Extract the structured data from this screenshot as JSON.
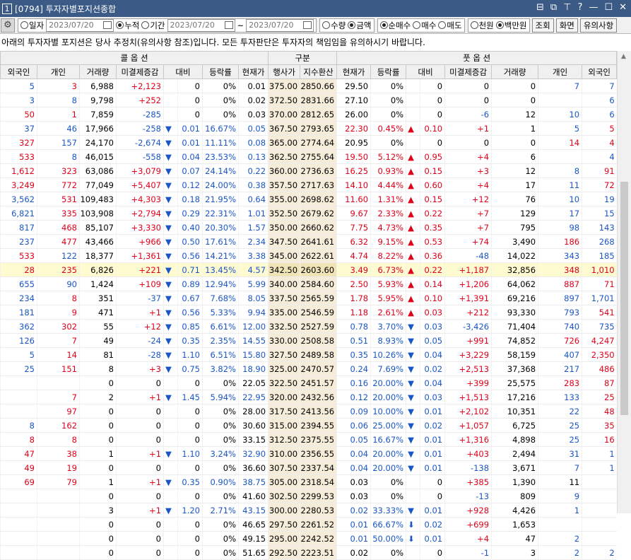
{
  "window": {
    "screen_no": "1",
    "title": "[0794] 투자자별포지션종합",
    "controls": [
      "⊟",
      "⧉",
      "⊤",
      "?",
      "—",
      "☐",
      "✕"
    ]
  },
  "toolbar": {
    "settings_icon": "gear-icon",
    "date_mode": {
      "daily": "일자",
      "cumulative": "누적",
      "period": "기간",
      "selected": "누적"
    },
    "date1": "2023/07/20",
    "date2": "2023/07/20",
    "date3": "2023/07/20",
    "tilde": "~",
    "unit": {
      "qty": "수량",
      "amount": "금액",
      "selected": "금액"
    },
    "trade": {
      "net": "순매수",
      "buy": "매수",
      "sell": "매도",
      "selected": "순매수"
    },
    "money": {
      "won": "천원",
      "million": "백만원",
      "selected": "백만원"
    },
    "query": "조회",
    "screen": "화면",
    "notice_btn": "유의사항"
  },
  "notice": "아래의 투자자별 포지션은 당사 추정치(유의사항 참조)입니다. 모든 투자판단은 투자자의 책임임을 유의하시기 바랍니다.",
  "header": {
    "call": "콜 옵 션",
    "mid": "구분",
    "put": "풋 옵 션",
    "columns": [
      "외국인",
      "개인",
      "거래량",
      "미결제증감",
      "대비",
      "등락률",
      "현재가",
      "행사가",
      "지수환산",
      "현재가",
      "등락률",
      "대비",
      "미결제증감",
      "거래량",
      "개인",
      "외국인"
    ]
  },
  "colors": {
    "up": "#e0001a",
    "down": "#1a56c8",
    "strike_bg": "#f5ecd9",
    "selected_row": "#fffbd1"
  },
  "rows": [
    [
      "5",
      "3",
      "6,988",
      "+2,123",
      "",
      "0",
      "0%",
      "0.01",
      "375.00",
      "2850.66",
      "29.50",
      "0%",
      "",
      "0",
      "0",
      "0",
      "7",
      "7"
    ],
    [
      "3",
      "8",
      "9,798",
      "+252",
      "",
      "0",
      "0%",
      "0.02",
      "372.50",
      "2831.66",
      "27.10",
      "0%",
      "",
      "0",
      "0",
      "0",
      "",
      "6"
    ],
    [
      "50",
      "1",
      "7,859",
      "-285",
      "",
      "0",
      "0%",
      "0.03",
      "370.00",
      "2812.65",
      "26.00",
      "0%",
      "",
      "0",
      "-6",
      "12",
      "10",
      "6"
    ],
    [
      "37",
      "46",
      "17,966",
      "-258",
      "▼",
      "0.01",
      "16.67%",
      "0.05",
      "367.50",
      "2793.65",
      "22.30",
      "0.45%",
      "▲",
      "0.10",
      "+1",
      "1",
      "5",
      "5"
    ],
    [
      "327",
      "157",
      "24,170",
      "-2,674",
      "▼",
      "0.01",
      "11.11%",
      "0.08",
      "365.00",
      "2774.64",
      "20.95",
      "0%",
      "",
      "0",
      "0",
      "0",
      "14",
      "4"
    ],
    [
      "533",
      "8",
      "46,015",
      "-558",
      "▼",
      "0.04",
      "23.53%",
      "0.13",
      "362.50",
      "2755.64",
      "19.50",
      "5.12%",
      "▲",
      "0.95",
      "+4",
      "6",
      "",
      "4"
    ],
    [
      "1,612",
      "323",
      "63,086",
      "+3,079",
      "▼",
      "0.07",
      "24.14%",
      "0.22",
      "360.00",
      "2736.63",
      "16.25",
      "0.93%",
      "▲",
      "0.15",
      "+3",
      "12",
      "8",
      "91"
    ],
    [
      "3,249",
      "772",
      "77,049",
      "+5,407",
      "▼",
      "0.12",
      "24.00%",
      "0.38",
      "357.50",
      "2717.63",
      "14.10",
      "4.44%",
      "▲",
      "0.60",
      "+4",
      "17",
      "11",
      "72"
    ],
    [
      "3,562",
      "531",
      "109,483",
      "+4,303",
      "▼",
      "0.18",
      "21.95%",
      "0.64",
      "355.00",
      "2698.62",
      "11.60",
      "1.31%",
      "▲",
      "0.15",
      "+12",
      "76",
      "10",
      "19"
    ],
    [
      "6,821",
      "335",
      "103,908",
      "+2,794",
      "▼",
      "0.29",
      "22.31%",
      "1.01",
      "352.50",
      "2679.62",
      "9.67",
      "2.33%",
      "▲",
      "0.22",
      "+7",
      "129",
      "17",
      "15"
    ],
    [
      "817",
      "468",
      "85,107",
      "+3,330",
      "▼",
      "0.40",
      "20.30%",
      "1.57",
      "350.00",
      "2660.62",
      "7.75",
      "4.73%",
      "▲",
      "0.35",
      "+7",
      "795",
      "98",
      "143"
    ],
    [
      "237",
      "477",
      "43,466",
      "+966",
      "▼",
      "0.50",
      "17.61%",
      "2.34",
      "347.50",
      "2641.61",
      "6.32",
      "9.15%",
      "▲",
      "0.53",
      "+74",
      "3,490",
      "186",
      "268"
    ],
    [
      "533",
      "122",
      "18,377",
      "+1,361",
      "▼",
      "0.56",
      "14.21%",
      "3.38",
      "345.00",
      "2622.61",
      "4.74",
      "8.22%",
      "▲",
      "0.36",
      "-48",
      "14,022",
      "343",
      "185"
    ],
    [
      "28",
      "235",
      "6,826",
      "+221",
      "▼",
      "0.71",
      "13.45%",
      "4.57",
      "342.50",
      "2603.60",
      "3.49",
      "6.73%",
      "▲",
      "0.22",
      "+1,187",
      "32,856",
      "348",
      "1,010"
    ],
    [
      "655",
      "90",
      "1,424",
      "+109",
      "▼",
      "0.89",
      "12.94%",
      "5.99",
      "340.00",
      "2584.60",
      "2.50",
      "5.93%",
      "▲",
      "0.14",
      "+1,206",
      "64,062",
      "887",
      "71"
    ],
    [
      "234",
      "8",
      "351",
      "-37",
      "▼",
      "0.67",
      "7.68%",
      "8.05",
      "337.50",
      "2565.59",
      "1.78",
      "5.95%",
      "▲",
      "0.10",
      "+1,391",
      "69,216",
      "897",
      "1,701"
    ],
    [
      "181",
      "9",
      "471",
      "+1",
      "▼",
      "0.56",
      "5.33%",
      "9.94",
      "335.00",
      "2546.59",
      "1.18",
      "2.61%",
      "▲",
      "0.03",
      "+212",
      "93,330",
      "793",
      "541"
    ],
    [
      "362",
      "302",
      "55",
      "+12",
      "▼",
      "0.85",
      "6.61%",
      "12.00",
      "332.50",
      "2527.59",
      "0.78",
      "3.70%",
      "▼",
      "0.03",
      "-3,426",
      "71,404",
      "740",
      "735"
    ],
    [
      "126",
      "7",
      "49",
      "-24",
      "▼",
      "0.35",
      "2.35%",
      "14.55",
      "330.00",
      "2508.58",
      "0.51",
      "8.93%",
      "▼",
      "0.05",
      "+991",
      "74,852",
      "726",
      "4,247"
    ],
    [
      "5",
      "14",
      "81",
      "-28",
      "▼",
      "1.10",
      "6.51%",
      "15.80",
      "327.50",
      "2489.58",
      "0.35",
      "10.26%",
      "▼",
      "0.04",
      "+3,229",
      "58,159",
      "407",
      "2,350"
    ],
    [
      "25",
      "151",
      "8",
      "+3",
      "▼",
      "0.75",
      "3.82%",
      "18.90",
      "325.00",
      "2470.57",
      "0.24",
      "7.69%",
      "▼",
      "0.02",
      "+2,513",
      "37,368",
      "217",
      "486"
    ],
    [
      "",
      "",
      "0",
      "0",
      "",
      "0",
      "0%",
      "22.05",
      "322.50",
      "2451.57",
      "0.16",
      "20.00%",
      "▼",
      "0.04",
      "+399",
      "25,575",
      "283",
      "87"
    ],
    [
      "",
      "7",
      "2",
      "+1",
      "▼",
      "1.45",
      "5.94%",
      "22.95",
      "320.00",
      "2432.56",
      "0.12",
      "20.00%",
      "▼",
      "0.03",
      "+1,513",
      "17,216",
      "133",
      "25"
    ],
    [
      "",
      "97",
      "0",
      "0",
      "",
      "0",
      "0%",
      "28.00",
      "317.50",
      "2413.56",
      "0.09",
      "10.00%",
      "▼",
      "0.01",
      "+2,102",
      "10,351",
      "22",
      "48"
    ],
    [
      "8",
      "162",
      "0",
      "0",
      "",
      "0",
      "0%",
      "30.60",
      "315.00",
      "2394.55",
      "0.06",
      "25.00%",
      "▼",
      "0.02",
      "+1,057",
      "6,725",
      "25",
      "35"
    ],
    [
      "8",
      "8",
      "0",
      "0",
      "",
      "0",
      "0%",
      "33.15",
      "312.50",
      "2375.55",
      "0.05",
      "16.67%",
      "▼",
      "0.01",
      "+1,316",
      "4,898",
      "25",
      "16"
    ],
    [
      "47",
      "38",
      "1",
      "+1",
      "▼",
      "1.10",
      "3.24%",
      "32.90",
      "310.00",
      "2356.55",
      "0.04",
      "20.00%",
      "▼",
      "0.01",
      "+403",
      "2,494",
      "31",
      "1"
    ],
    [
      "49",
      "19",
      "0",
      "0",
      "",
      "0",
      "0%",
      "36.60",
      "307.50",
      "2337.54",
      "0.04",
      "20.00%",
      "▼",
      "0.01",
      "-138",
      "3,671",
      "7",
      "1"
    ],
    [
      "69",
      "79",
      "1",
      "+1",
      "▼",
      "0.35",
      "0.90%",
      "38.75",
      "305.00",
      "2318.54",
      "0.03",
      "0%",
      "",
      "0",
      "+385",
      "1,390",
      "11",
      ""
    ],
    [
      "",
      "",
      "0",
      "0",
      "",
      "0",
      "0%",
      "41.60",
      "302.50",
      "2299.53",
      "0.03",
      "0%",
      "",
      "0",
      "-13",
      "809",
      "9",
      ""
    ],
    [
      "",
      "",
      "3",
      "+1",
      "▼",
      "1.20",
      "2.71%",
      "43.15",
      "300.00",
      "2280.53",
      "0.02",
      "33.33%",
      "▼",
      "0.01",
      "+928",
      "4,426",
      "1",
      ""
    ],
    [
      "",
      "",
      "0",
      "0",
      "",
      "0",
      "0%",
      "46.65",
      "297.50",
      "2261.52",
      "0.01",
      "66.67%",
      "⬇",
      "0.02",
      "+699",
      "1,653",
      "",
      ""
    ],
    [
      "",
      "",
      "0",
      "0",
      "",
      "0",
      "0%",
      "49.15",
      "295.00",
      "2242.52",
      "0.01",
      "50.00%",
      "⬇",
      "0.01",
      "+4",
      "47",
      "2",
      ""
    ],
    [
      "",
      "",
      "0",
      "0",
      "",
      "0",
      "0%",
      "51.65",
      "292.50",
      "2223.51",
      "0.02",
      "0%",
      "",
      "0",
      "-1",
      "3",
      "2",
      "2"
    ]
  ],
  "row_styles": [
    [
      "dn",
      "up",
      "",
      "up",
      "",
      "",
      "",
      "",
      "",
      "",
      "",
      "",
      "",
      "",
      "",
      "",
      "dn",
      "dn"
    ],
    [
      "dn",
      "dn",
      "",
      "up",
      "",
      "",
      "",
      "",
      "",
      "",
      "",
      "",
      "",
      "",
      "",
      "",
      "",
      "dn"
    ],
    [
      "up",
      "up",
      "",
      "dn",
      "",
      "",
      "",
      "",
      "",
      "",
      "",
      "",
      "",
      "",
      "dn",
      "",
      "dn",
      "dn"
    ],
    [
      "dn",
      "dn",
      "",
      "dn",
      "dn",
      "dn",
      "dn",
      "dn",
      "",
      "",
      "up",
      "up",
      "up",
      "up",
      "up",
      "",
      "dn",
      "up"
    ],
    [
      "up",
      "dn",
      "",
      "dn",
      "dn",
      "dn",
      "dn",
      "dn",
      "",
      "",
      "",
      "",
      "",
      "",
      "",
      "",
      "up",
      "up"
    ],
    [
      "up",
      "dn",
      "",
      "dn",
      "dn",
      "dn",
      "dn",
      "dn",
      "",
      "",
      "up",
      "up",
      "up",
      "up",
      "up",
      "",
      "",
      "dn"
    ],
    [
      "up",
      "up",
      "",
      "up",
      "dn",
      "dn",
      "dn",
      "dn",
      "",
      "",
      "up",
      "up",
      "up",
      "up",
      "up",
      "",
      "dn",
      "up"
    ],
    [
      "up",
      "up",
      "",
      "up",
      "dn",
      "dn",
      "dn",
      "dn",
      "",
      "",
      "up",
      "up",
      "up",
      "up",
      "up",
      "",
      "dn",
      "up"
    ],
    [
      "dn",
      "up",
      "",
      "up",
      "dn",
      "dn",
      "dn",
      "dn",
      "",
      "",
      "up",
      "up",
      "up",
      "up",
      "up",
      "",
      "dn",
      "dn"
    ],
    [
      "dn",
      "up",
      "",
      "up",
      "dn",
      "dn",
      "dn",
      "dn",
      "",
      "",
      "up",
      "up",
      "up",
      "up",
      "up",
      "",
      "dn",
      "dn"
    ],
    [
      "dn",
      "up",
      "",
      "up",
      "dn",
      "dn",
      "dn",
      "dn",
      "",
      "",
      "up",
      "up",
      "up",
      "up",
      "up",
      "",
      "dn",
      "dn"
    ],
    [
      "dn",
      "up",
      "",
      "up",
      "dn",
      "dn",
      "dn",
      "dn",
      "",
      "",
      "up",
      "up",
      "up",
      "up",
      "up",
      "",
      "up",
      "dn"
    ],
    [
      "up",
      "dn",
      "",
      "up",
      "dn",
      "dn",
      "dn",
      "dn",
      "",
      "",
      "up",
      "up",
      "up",
      "up",
      "dn",
      "",
      "dn",
      "dn"
    ],
    [
      "up",
      "up",
      "",
      "up",
      "dn",
      "dn",
      "dn",
      "dn",
      "",
      "",
      "up",
      "up",
      "up",
      "up",
      "up",
      "",
      "up",
      "up"
    ],
    [
      "dn",
      "dn",
      "",
      "up",
      "dn",
      "dn",
      "dn",
      "dn",
      "",
      "",
      "up",
      "up",
      "up",
      "up",
      "up",
      "",
      "up",
      "up"
    ],
    [
      "dn",
      "up",
      "",
      "dn",
      "dn",
      "dn",
      "dn",
      "dn",
      "",
      "",
      "up",
      "up",
      "up",
      "up",
      "up",
      "",
      "dn",
      "dn"
    ],
    [
      "dn",
      "up",
      "",
      "up",
      "dn",
      "dn",
      "dn",
      "dn",
      "",
      "",
      "up",
      "up",
      "up",
      "up",
      "up",
      "",
      "dn",
      "up"
    ],
    [
      "dn",
      "up",
      "",
      "up",
      "dn",
      "dn",
      "dn",
      "dn",
      "",
      "",
      "dn",
      "dn",
      "dn",
      "dn",
      "dn",
      "",
      "dn",
      "dn"
    ],
    [
      "dn",
      "up",
      "",
      "dn",
      "dn",
      "dn",
      "dn",
      "dn",
      "",
      "",
      "dn",
      "dn",
      "dn",
      "dn",
      "up",
      "",
      "up",
      "up"
    ],
    [
      "dn",
      "up",
      "",
      "dn",
      "dn",
      "dn",
      "dn",
      "dn",
      "",
      "",
      "dn",
      "dn",
      "dn",
      "dn",
      "up",
      "",
      "dn",
      "up"
    ],
    [
      "dn",
      "up",
      "",
      "up",
      "dn",
      "dn",
      "dn",
      "dn",
      "",
      "",
      "dn",
      "dn",
      "dn",
      "dn",
      "up",
      "",
      "dn",
      "up"
    ],
    [
      "",
      "",
      "",
      "",
      "",
      "",
      "",
      "",
      "",
      "",
      "dn",
      "dn",
      "dn",
      "dn",
      "up",
      "",
      "up",
      "up"
    ],
    [
      "",
      "up",
      "",
      "up",
      "dn",
      "dn",
      "dn",
      "dn",
      "",
      "",
      "dn",
      "dn",
      "dn",
      "dn",
      "up",
      "",
      "dn",
      "up"
    ],
    [
      "",
      "up",
      "",
      "",
      "",
      "",
      "",
      "",
      "",
      "",
      "dn",
      "dn",
      "dn",
      "dn",
      "up",
      "",
      "dn",
      "up"
    ],
    [
      "dn",
      "up",
      "",
      "",
      "",
      "",
      "",
      "",
      "",
      "",
      "dn",
      "dn",
      "dn",
      "dn",
      "up",
      "",
      "dn",
      "up"
    ],
    [
      "up",
      "up",
      "",
      "",
      "",
      "",
      "",
      "",
      "",
      "",
      "dn",
      "dn",
      "dn",
      "dn",
      "up",
      "",
      "dn",
      "up"
    ],
    [
      "up",
      "up",
      "",
      "up",
      "dn",
      "dn",
      "dn",
      "dn",
      "",
      "",
      "dn",
      "dn",
      "dn",
      "dn",
      "up",
      "",
      "dn",
      "dn"
    ],
    [
      "up",
      "up",
      "",
      "",
      "",
      "",
      "",
      "",
      "",
      "",
      "dn",
      "dn",
      "dn",
      "dn",
      "dn",
      "",
      "dn",
      "dn"
    ],
    [
      "up",
      "up",
      "",
      "up",
      "dn",
      "dn",
      "dn",
      "dn",
      "",
      "",
      "",
      "",
      "",
      "",
      "up",
      "",
      "",
      ""
    ],
    [
      "",
      "",
      "",
      "",
      "",
      "",
      "",
      "",
      "",
      "",
      "",
      "",
      "",
      "",
      "dn",
      "",
      "dn",
      ""
    ],
    [
      "",
      "",
      "",
      "up",
      "dn",
      "dn",
      "dn",
      "dn",
      "",
      "",
      "dn",
      "dn",
      "dn",
      "dn",
      "up",
      "",
      "dn",
      ""
    ],
    [
      "",
      "",
      "",
      "",
      "",
      "",
      "",
      "",
      "",
      "",
      "dn",
      "dn",
      "dn",
      "dn",
      "up",
      "",
      "",
      ""
    ],
    [
      "",
      "",
      "",
      "",
      "",
      "",
      "",
      "",
      "",
      "",
      "dn",
      "dn",
      "dn",
      "dn",
      "up",
      "",
      "dn",
      ""
    ],
    [
      "",
      "",
      "",
      "",
      "",
      "",
      "",
      "",
      "",
      "",
      "",
      "",
      "",
      "",
      "dn",
      "",
      "dn",
      "dn"
    ]
  ],
  "selected_row": 13
}
